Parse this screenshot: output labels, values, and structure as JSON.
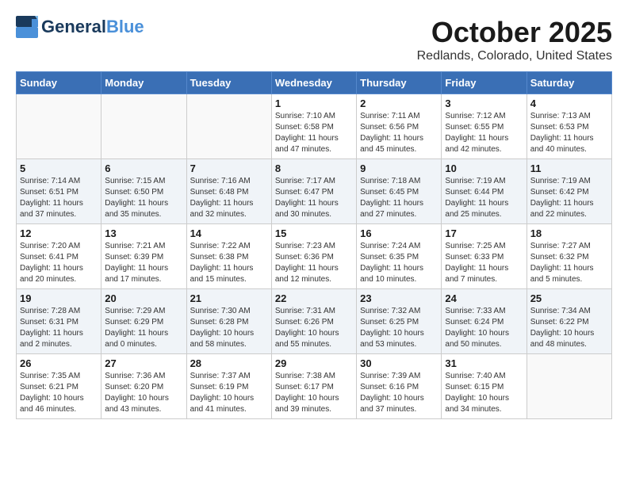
{
  "header": {
    "logo_general": "General",
    "logo_blue": "Blue",
    "month": "October 2025",
    "location": "Redlands, Colorado, United States"
  },
  "weekdays": [
    "Sunday",
    "Monday",
    "Tuesday",
    "Wednesday",
    "Thursday",
    "Friday",
    "Saturday"
  ],
  "weeks": [
    [
      {
        "day": "",
        "sunrise": "",
        "sunset": "",
        "daylight": "",
        "empty": true
      },
      {
        "day": "",
        "sunrise": "",
        "sunset": "",
        "daylight": "",
        "empty": true
      },
      {
        "day": "",
        "sunrise": "",
        "sunset": "",
        "daylight": "",
        "empty": true
      },
      {
        "day": "1",
        "sunrise": "Sunrise: 7:10 AM",
        "sunset": "Sunset: 6:58 PM",
        "daylight": "Daylight: 11 hours and 47 minutes.",
        "empty": false
      },
      {
        "day": "2",
        "sunrise": "Sunrise: 7:11 AM",
        "sunset": "Sunset: 6:56 PM",
        "daylight": "Daylight: 11 hours and 45 minutes.",
        "empty": false
      },
      {
        "day": "3",
        "sunrise": "Sunrise: 7:12 AM",
        "sunset": "Sunset: 6:55 PM",
        "daylight": "Daylight: 11 hours and 42 minutes.",
        "empty": false
      },
      {
        "day": "4",
        "sunrise": "Sunrise: 7:13 AM",
        "sunset": "Sunset: 6:53 PM",
        "daylight": "Daylight: 11 hours and 40 minutes.",
        "empty": false
      }
    ],
    [
      {
        "day": "5",
        "sunrise": "Sunrise: 7:14 AM",
        "sunset": "Sunset: 6:51 PM",
        "daylight": "Daylight: 11 hours and 37 minutes.",
        "empty": false
      },
      {
        "day": "6",
        "sunrise": "Sunrise: 7:15 AM",
        "sunset": "Sunset: 6:50 PM",
        "daylight": "Daylight: 11 hours and 35 minutes.",
        "empty": false
      },
      {
        "day": "7",
        "sunrise": "Sunrise: 7:16 AM",
        "sunset": "Sunset: 6:48 PM",
        "daylight": "Daylight: 11 hours and 32 minutes.",
        "empty": false
      },
      {
        "day": "8",
        "sunrise": "Sunrise: 7:17 AM",
        "sunset": "Sunset: 6:47 PM",
        "daylight": "Daylight: 11 hours and 30 minutes.",
        "empty": false
      },
      {
        "day": "9",
        "sunrise": "Sunrise: 7:18 AM",
        "sunset": "Sunset: 6:45 PM",
        "daylight": "Daylight: 11 hours and 27 minutes.",
        "empty": false
      },
      {
        "day": "10",
        "sunrise": "Sunrise: 7:19 AM",
        "sunset": "Sunset: 6:44 PM",
        "daylight": "Daylight: 11 hours and 25 minutes.",
        "empty": false
      },
      {
        "day": "11",
        "sunrise": "Sunrise: 7:19 AM",
        "sunset": "Sunset: 6:42 PM",
        "daylight": "Daylight: 11 hours and 22 minutes.",
        "empty": false
      }
    ],
    [
      {
        "day": "12",
        "sunrise": "Sunrise: 7:20 AM",
        "sunset": "Sunset: 6:41 PM",
        "daylight": "Daylight: 11 hours and 20 minutes.",
        "empty": false
      },
      {
        "day": "13",
        "sunrise": "Sunrise: 7:21 AM",
        "sunset": "Sunset: 6:39 PM",
        "daylight": "Daylight: 11 hours and 17 minutes.",
        "empty": false
      },
      {
        "day": "14",
        "sunrise": "Sunrise: 7:22 AM",
        "sunset": "Sunset: 6:38 PM",
        "daylight": "Daylight: 11 hours and 15 minutes.",
        "empty": false
      },
      {
        "day": "15",
        "sunrise": "Sunrise: 7:23 AM",
        "sunset": "Sunset: 6:36 PM",
        "daylight": "Daylight: 11 hours and 12 minutes.",
        "empty": false
      },
      {
        "day": "16",
        "sunrise": "Sunrise: 7:24 AM",
        "sunset": "Sunset: 6:35 PM",
        "daylight": "Daylight: 11 hours and 10 minutes.",
        "empty": false
      },
      {
        "day": "17",
        "sunrise": "Sunrise: 7:25 AM",
        "sunset": "Sunset: 6:33 PM",
        "daylight": "Daylight: 11 hours and 7 minutes.",
        "empty": false
      },
      {
        "day": "18",
        "sunrise": "Sunrise: 7:27 AM",
        "sunset": "Sunset: 6:32 PM",
        "daylight": "Daylight: 11 hours and 5 minutes.",
        "empty": false
      }
    ],
    [
      {
        "day": "19",
        "sunrise": "Sunrise: 7:28 AM",
        "sunset": "Sunset: 6:31 PM",
        "daylight": "Daylight: 11 hours and 2 minutes.",
        "empty": false
      },
      {
        "day": "20",
        "sunrise": "Sunrise: 7:29 AM",
        "sunset": "Sunset: 6:29 PM",
        "daylight": "Daylight: 11 hours and 0 minutes.",
        "empty": false
      },
      {
        "day": "21",
        "sunrise": "Sunrise: 7:30 AM",
        "sunset": "Sunset: 6:28 PM",
        "daylight": "Daylight: 10 hours and 58 minutes.",
        "empty": false
      },
      {
        "day": "22",
        "sunrise": "Sunrise: 7:31 AM",
        "sunset": "Sunset: 6:26 PM",
        "daylight": "Daylight: 10 hours and 55 minutes.",
        "empty": false
      },
      {
        "day": "23",
        "sunrise": "Sunrise: 7:32 AM",
        "sunset": "Sunset: 6:25 PM",
        "daylight": "Daylight: 10 hours and 53 minutes.",
        "empty": false
      },
      {
        "day": "24",
        "sunrise": "Sunrise: 7:33 AM",
        "sunset": "Sunset: 6:24 PM",
        "daylight": "Daylight: 10 hours and 50 minutes.",
        "empty": false
      },
      {
        "day": "25",
        "sunrise": "Sunrise: 7:34 AM",
        "sunset": "Sunset: 6:22 PM",
        "daylight": "Daylight: 10 hours and 48 minutes.",
        "empty": false
      }
    ],
    [
      {
        "day": "26",
        "sunrise": "Sunrise: 7:35 AM",
        "sunset": "Sunset: 6:21 PM",
        "daylight": "Daylight: 10 hours and 46 minutes.",
        "empty": false
      },
      {
        "day": "27",
        "sunrise": "Sunrise: 7:36 AM",
        "sunset": "Sunset: 6:20 PM",
        "daylight": "Daylight: 10 hours and 43 minutes.",
        "empty": false
      },
      {
        "day": "28",
        "sunrise": "Sunrise: 7:37 AM",
        "sunset": "Sunset: 6:19 PM",
        "daylight": "Daylight: 10 hours and 41 minutes.",
        "empty": false
      },
      {
        "day": "29",
        "sunrise": "Sunrise: 7:38 AM",
        "sunset": "Sunset: 6:17 PM",
        "daylight": "Daylight: 10 hours and 39 minutes.",
        "empty": false
      },
      {
        "day": "30",
        "sunrise": "Sunrise: 7:39 AM",
        "sunset": "Sunset: 6:16 PM",
        "daylight": "Daylight: 10 hours and 37 minutes.",
        "empty": false
      },
      {
        "day": "31",
        "sunrise": "Sunrise: 7:40 AM",
        "sunset": "Sunset: 6:15 PM",
        "daylight": "Daylight: 10 hours and 34 minutes.",
        "empty": false
      },
      {
        "day": "",
        "sunrise": "",
        "sunset": "",
        "daylight": "",
        "empty": true
      }
    ]
  ]
}
